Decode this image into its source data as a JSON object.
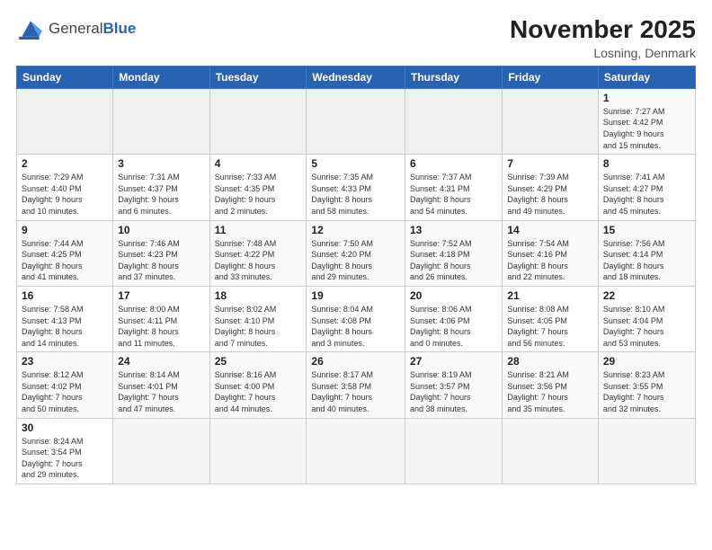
{
  "header": {
    "logo_text_general": "General",
    "logo_text_blue": "Blue",
    "month_title": "November 2025",
    "location": "Losning, Denmark"
  },
  "weekdays": [
    "Sunday",
    "Monday",
    "Tuesday",
    "Wednesday",
    "Thursday",
    "Friday",
    "Saturday"
  ],
  "weeks": [
    [
      {
        "day": "",
        "info": "",
        "empty": true
      },
      {
        "day": "",
        "info": "",
        "empty": true
      },
      {
        "day": "",
        "info": "",
        "empty": true
      },
      {
        "day": "",
        "info": "",
        "empty": true
      },
      {
        "day": "",
        "info": "",
        "empty": true
      },
      {
        "day": "",
        "info": "",
        "empty": true
      },
      {
        "day": "1",
        "info": "Sunrise: 7:27 AM\nSunset: 4:42 PM\nDaylight: 9 hours\nand 15 minutes."
      }
    ],
    [
      {
        "day": "2",
        "info": "Sunrise: 7:29 AM\nSunset: 4:40 PM\nDaylight: 9 hours\nand 10 minutes."
      },
      {
        "day": "3",
        "info": "Sunrise: 7:31 AM\nSunset: 4:37 PM\nDaylight: 9 hours\nand 6 minutes."
      },
      {
        "day": "4",
        "info": "Sunrise: 7:33 AM\nSunset: 4:35 PM\nDaylight: 9 hours\nand 2 minutes."
      },
      {
        "day": "5",
        "info": "Sunrise: 7:35 AM\nSunset: 4:33 PM\nDaylight: 8 hours\nand 58 minutes."
      },
      {
        "day": "6",
        "info": "Sunrise: 7:37 AM\nSunset: 4:31 PM\nDaylight: 8 hours\nand 54 minutes."
      },
      {
        "day": "7",
        "info": "Sunrise: 7:39 AM\nSunset: 4:29 PM\nDaylight: 8 hours\nand 49 minutes."
      },
      {
        "day": "8",
        "info": "Sunrise: 7:41 AM\nSunset: 4:27 PM\nDaylight: 8 hours\nand 45 minutes."
      }
    ],
    [
      {
        "day": "9",
        "info": "Sunrise: 7:44 AM\nSunset: 4:25 PM\nDaylight: 8 hours\nand 41 minutes."
      },
      {
        "day": "10",
        "info": "Sunrise: 7:46 AM\nSunset: 4:23 PM\nDaylight: 8 hours\nand 37 minutes."
      },
      {
        "day": "11",
        "info": "Sunrise: 7:48 AM\nSunset: 4:22 PM\nDaylight: 8 hours\nand 33 minutes."
      },
      {
        "day": "12",
        "info": "Sunrise: 7:50 AM\nSunset: 4:20 PM\nDaylight: 8 hours\nand 29 minutes."
      },
      {
        "day": "13",
        "info": "Sunrise: 7:52 AM\nSunset: 4:18 PM\nDaylight: 8 hours\nand 26 minutes."
      },
      {
        "day": "14",
        "info": "Sunrise: 7:54 AM\nSunset: 4:16 PM\nDaylight: 8 hours\nand 22 minutes."
      },
      {
        "day": "15",
        "info": "Sunrise: 7:56 AM\nSunset: 4:14 PM\nDaylight: 8 hours\nand 18 minutes."
      }
    ],
    [
      {
        "day": "16",
        "info": "Sunrise: 7:58 AM\nSunset: 4:13 PM\nDaylight: 8 hours\nand 14 minutes."
      },
      {
        "day": "17",
        "info": "Sunrise: 8:00 AM\nSunset: 4:11 PM\nDaylight: 8 hours\nand 11 minutes."
      },
      {
        "day": "18",
        "info": "Sunrise: 8:02 AM\nSunset: 4:10 PM\nDaylight: 8 hours\nand 7 minutes."
      },
      {
        "day": "19",
        "info": "Sunrise: 8:04 AM\nSunset: 4:08 PM\nDaylight: 8 hours\nand 3 minutes."
      },
      {
        "day": "20",
        "info": "Sunrise: 8:06 AM\nSunset: 4:06 PM\nDaylight: 8 hours\nand 0 minutes."
      },
      {
        "day": "21",
        "info": "Sunrise: 8:08 AM\nSunset: 4:05 PM\nDaylight: 7 hours\nand 56 minutes."
      },
      {
        "day": "22",
        "info": "Sunrise: 8:10 AM\nSunset: 4:04 PM\nDaylight: 7 hours\nand 53 minutes."
      }
    ],
    [
      {
        "day": "23",
        "info": "Sunrise: 8:12 AM\nSunset: 4:02 PM\nDaylight: 7 hours\nand 50 minutes."
      },
      {
        "day": "24",
        "info": "Sunrise: 8:14 AM\nSunset: 4:01 PM\nDaylight: 7 hours\nand 47 minutes."
      },
      {
        "day": "25",
        "info": "Sunrise: 8:16 AM\nSunset: 4:00 PM\nDaylight: 7 hours\nand 44 minutes."
      },
      {
        "day": "26",
        "info": "Sunrise: 8:17 AM\nSunset: 3:58 PM\nDaylight: 7 hours\nand 40 minutes."
      },
      {
        "day": "27",
        "info": "Sunrise: 8:19 AM\nSunset: 3:57 PM\nDaylight: 7 hours\nand 38 minutes."
      },
      {
        "day": "28",
        "info": "Sunrise: 8:21 AM\nSunset: 3:56 PM\nDaylight: 7 hours\nand 35 minutes."
      },
      {
        "day": "29",
        "info": "Sunrise: 8:23 AM\nSunset: 3:55 PM\nDaylight: 7 hours\nand 32 minutes."
      }
    ],
    [
      {
        "day": "30",
        "info": "Sunrise: 8:24 AM\nSunset: 3:54 PM\nDaylight: 7 hours\nand 29 minutes."
      },
      {
        "day": "",
        "info": "",
        "empty": true
      },
      {
        "day": "",
        "info": "",
        "empty": true
      },
      {
        "day": "",
        "info": "",
        "empty": true
      },
      {
        "day": "",
        "info": "",
        "empty": true
      },
      {
        "day": "",
        "info": "",
        "empty": true
      },
      {
        "day": "",
        "info": "",
        "empty": true
      }
    ]
  ]
}
